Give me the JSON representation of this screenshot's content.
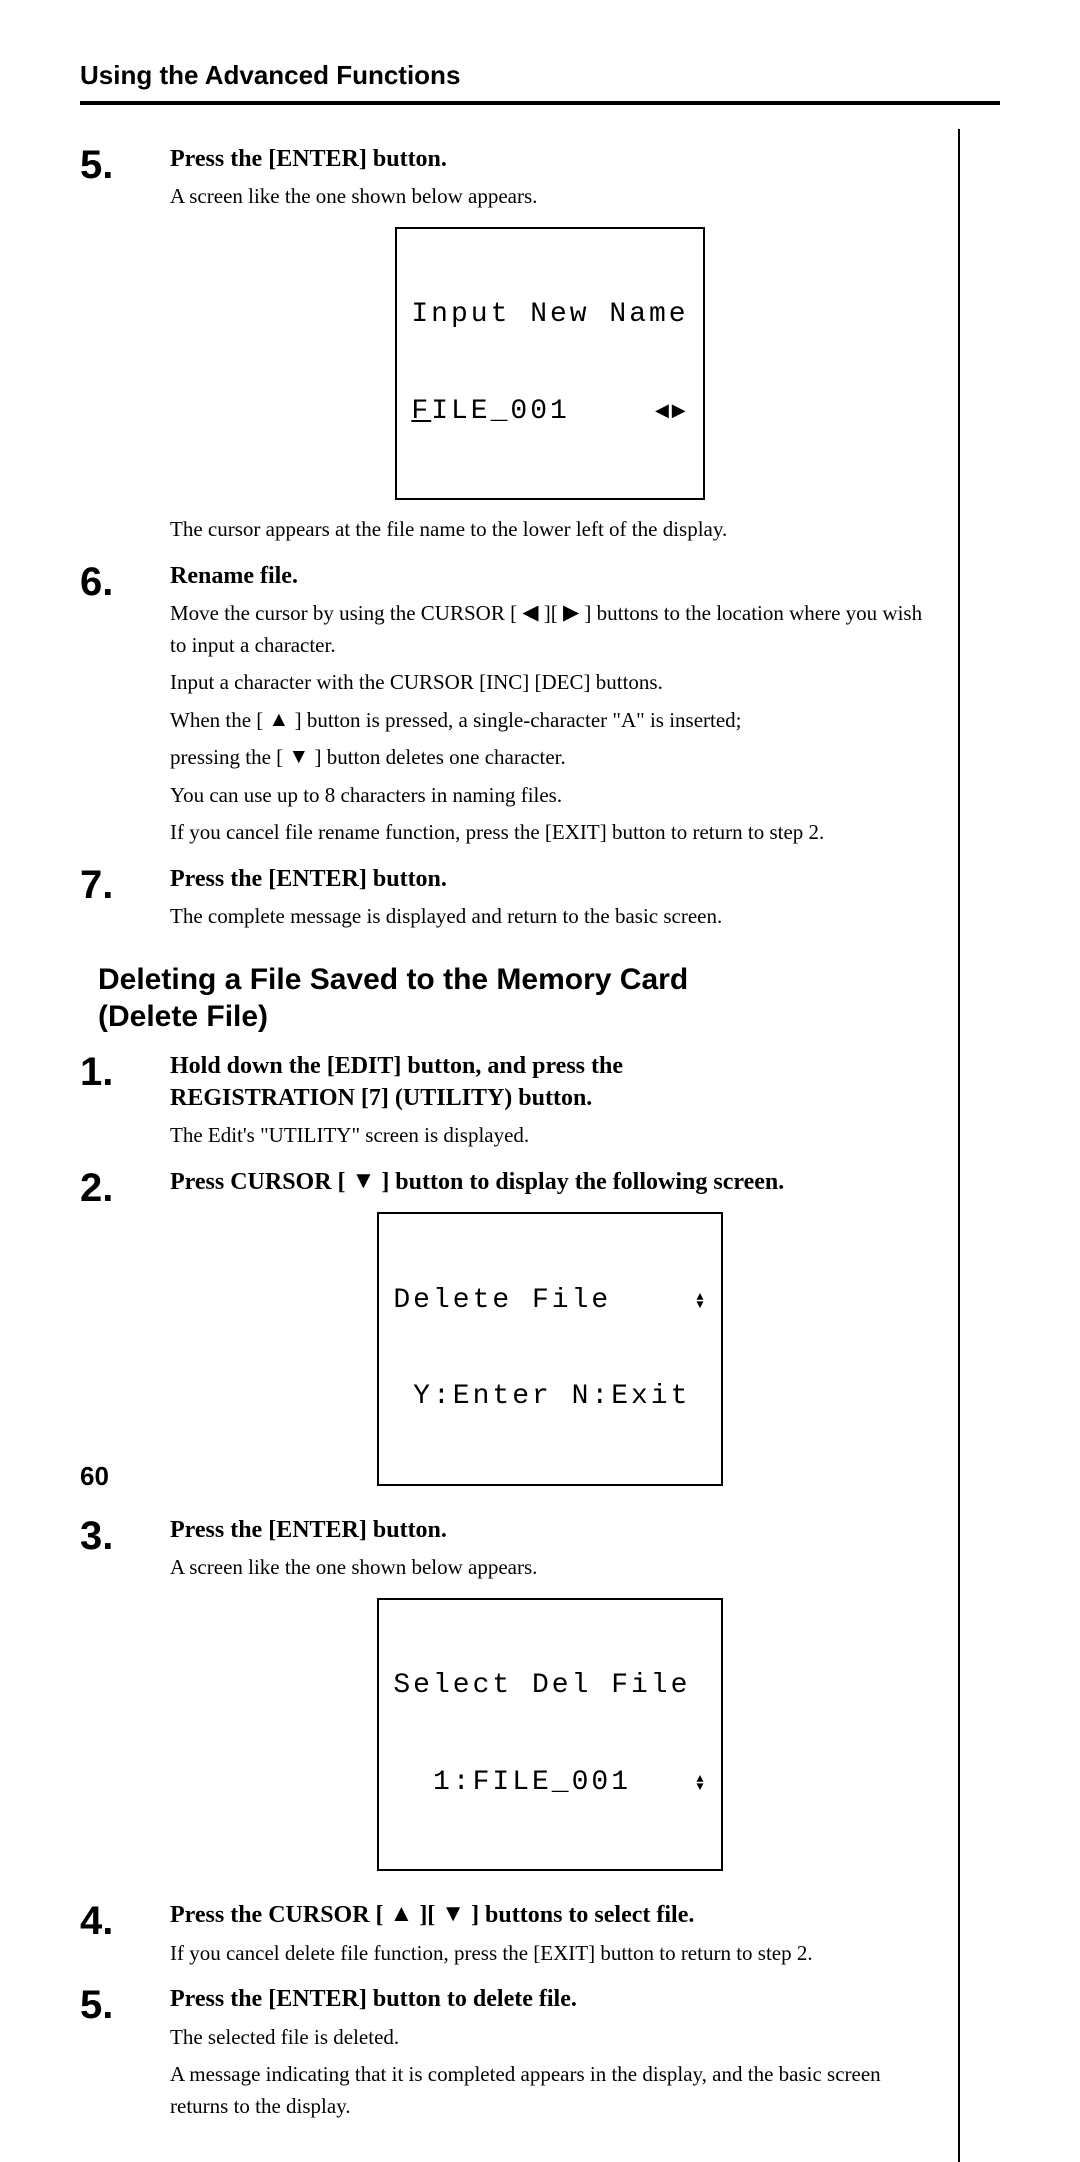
{
  "header": {
    "title": "Using the Advanced Functions"
  },
  "steps_a": {
    "s5": {
      "num": "5.",
      "head": "Press the [ENTER] button.",
      "para1": "A screen like the one shown below appears.",
      "lcd_line1": "Input New Name",
      "lcd_line2_pre": "F",
      "lcd_line2_rest": "ILE_001",
      "para2": "The cursor appears at the file name to the lower left of the display."
    },
    "s6": {
      "num": "6.",
      "head": "Rename file.",
      "para1a": "Move the cursor by using the CURSOR [ ",
      "para1b": " ][ ",
      "para1c": " ] buttons to the location where you wish to input a character.",
      "para2": "Input a character with the CURSOR [INC] [DEC] buttons.",
      "para3a": "When the [ ",
      "para3b": " ] button is pressed, a single-character \"A\" is inserted;",
      "para4a": "pressing the [ ",
      "para4b": " ] button deletes one character.",
      "para5": "You can use up to 8 characters in naming files.",
      "para6": "If you cancel file rename function, press the [EXIT] button to return to step 2."
    },
    "s7": {
      "num": "7.",
      "head": "Press the [ENTER] button.",
      "para1": "The complete message is displayed and return to the basic screen."
    }
  },
  "subsection": {
    "title_line1": "Deleting a File Saved to the Memory Card",
    "title_line2": "(Delete File)"
  },
  "steps_b": {
    "s1": {
      "num": "1.",
      "head_line1": "Hold down the [EDIT] button, and press the",
      "head_line2": "REGISTRATION [7] (UTILITY) button.",
      "para1": "The Edit's \"UTILITY\" screen is displayed."
    },
    "s2": {
      "num": "2.",
      "head_a": "Press CURSOR [ ",
      "head_b": " ] button to display the following screen.",
      "lcd_line1": "Delete File    ",
      "lcd_line2": " Y:Enter N:Exit"
    },
    "s3": {
      "num": "3.",
      "head": "Press the [ENTER] button.",
      "para1": "A screen like the one shown below appears.",
      "lcd_line1": "Select Del File",
      "lcd_line2": "  1:FILE_001   "
    },
    "s4": {
      "num": "4.",
      "head_a": "Press the CURSOR [ ",
      "head_b": " ][ ",
      "head_c": " ] buttons to select file.",
      "para1": "If you cancel delete file function, press the [EXIT] button to return to step 2."
    },
    "s5": {
      "num": "5.",
      "head": "Press the [ENTER] button to delete file.",
      "para1": "The selected file is deleted.",
      "para2": "A message indicating that it is completed appears in the display, and the basic screen returns to the display."
    }
  },
  "page_number": "60"
}
